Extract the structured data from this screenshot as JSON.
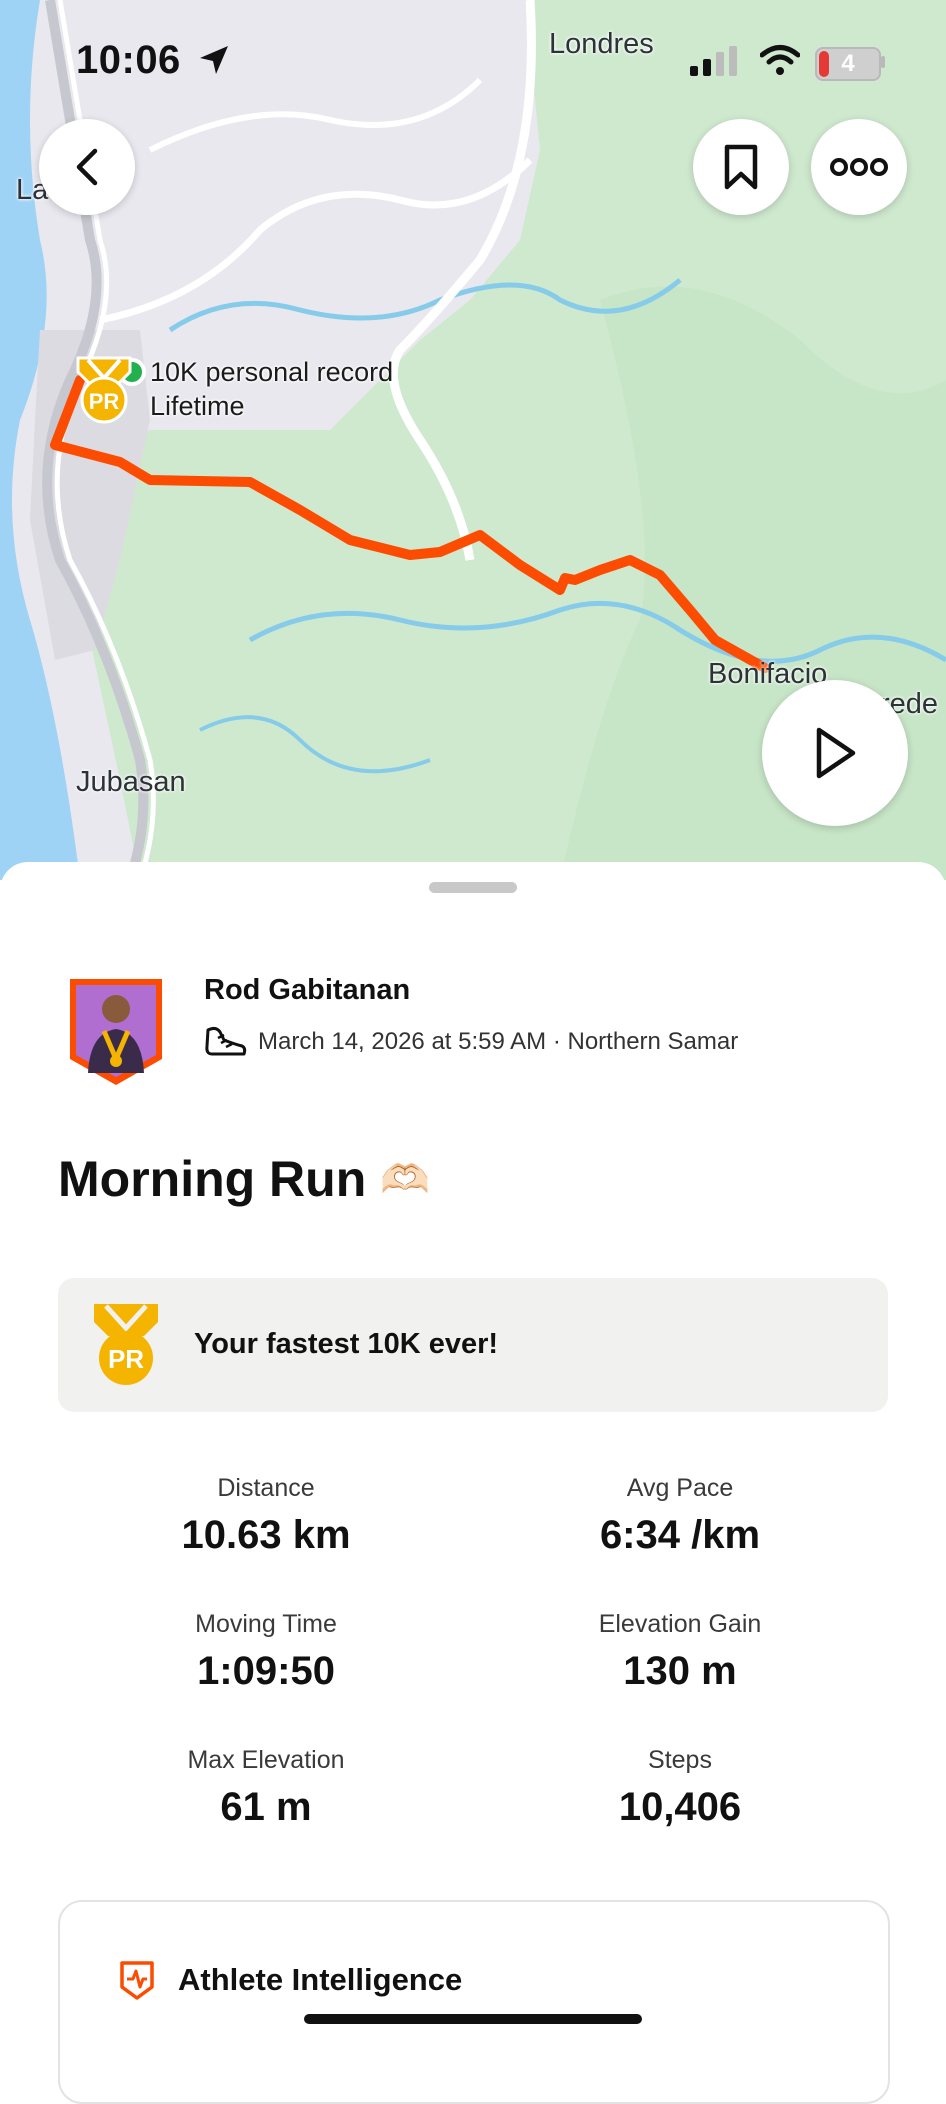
{
  "status_bar": {
    "time": "10:06",
    "battery": "4"
  },
  "map": {
    "places": [
      "Londres",
      "La",
      "Jubasan",
      "Bonifacio",
      "rede"
    ],
    "pr_marker": {
      "line1": "10K personal record",
      "line2": "Lifetime"
    }
  },
  "activity": {
    "athlete": "Rod Gabitanan",
    "meta": "March 14, 2026 at 5:59 AM · Northern Samar",
    "title": "Morning Run",
    "title_emoji": "🫶🏻",
    "pr_text": "Your fastest 10K ever!",
    "stats": [
      {
        "label": "Distance",
        "value": "10.63 km"
      },
      {
        "label": "Avg Pace",
        "value": "6:34 /km"
      },
      {
        "label": "Moving Time",
        "value": "1:09:50"
      },
      {
        "label": "Elevation Gain",
        "value": "130 m"
      },
      {
        "label": "Max Elevation",
        "value": "61 m"
      },
      {
        "label": "Steps",
        "value": "10,406"
      }
    ],
    "intelligence_title": "Athlete Intelligence"
  },
  "colors": {
    "route": "#fc4c02",
    "accent": "#fc4c02",
    "pr_gold": "#f4b400",
    "water": "#9fd3f5",
    "forest": "#cfe9cf"
  },
  "icons": [
    "back-icon",
    "bookmark-icon",
    "more-icon",
    "play-icon",
    "shoe-icon",
    "pr-medal-icon",
    "athlete-intelligence-icon"
  ]
}
